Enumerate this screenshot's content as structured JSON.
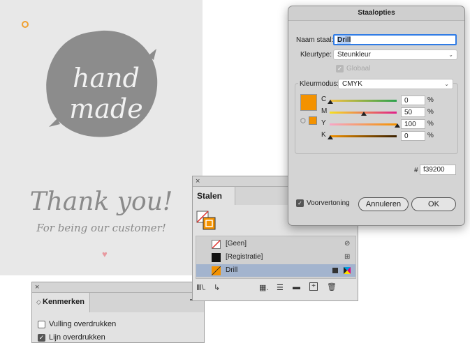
{
  "artwork": {
    "line1": "hand",
    "line2": "made",
    "thank": "Thank you!",
    "sub": "For being our customer!",
    "heart": "♥"
  },
  "kenmerken": {
    "close": "×",
    "tab": "Kenmerken",
    "tab_icon": "◇",
    "items": [
      {
        "label": "Vulling overdrukken",
        "checked": false
      },
      {
        "label": "Lijn overdrukken",
        "checked": true
      }
    ]
  },
  "stalen": {
    "close": "×",
    "tab": "Stalen",
    "swatches": [
      {
        "name": "[Geen]",
        "icon": "no-print-icon"
      },
      {
        "name": "[Registratie]",
        "icon": "registration-icon"
      },
      {
        "name": "Drill",
        "icon": "process-color-icon",
        "selected": true
      }
    ],
    "toolbar_icons": [
      "library-icon",
      "import-icon",
      "grid-icon",
      "list-icon",
      "folder-icon",
      "new-swatch-icon",
      "trash-icon"
    ],
    "toolbar_glyphs": {
      "library": "Ⅲ\\.",
      "import": "↳",
      "grid": "▦.",
      "list": "☰",
      "folder": "▬",
      "new": "+",
      "trash": "🗑"
    }
  },
  "dialog": {
    "title": "Staalopties",
    "name_label": "Naam staal:",
    "name_value": "Drill",
    "kleurtype_label": "Kleurtype:",
    "kleurtype_value": "Steunkleur",
    "globaal_label": "Globaal",
    "kleurmodus_label": "Kleurmodus:",
    "kleurmodus_value": "CMYK",
    "channels": [
      {
        "letter": "C",
        "value": "0",
        "level": 0
      },
      {
        "letter": "M",
        "value": "50",
        "level": 50
      },
      {
        "letter": "Y",
        "value": "100",
        "level": 100
      },
      {
        "letter": "K",
        "value": "0",
        "level": 0
      }
    ],
    "percent": "%",
    "hex_label": "#",
    "hex_value": "f39200",
    "preview_label": "Voorvertoning",
    "cancel": "Annuleren",
    "ok": "OK"
  },
  "colors": {
    "swatch": "#f39200",
    "accent": "#2f7be5",
    "selected_row": "#a3b4ce",
    "stain": "#8c8c8c"
  }
}
